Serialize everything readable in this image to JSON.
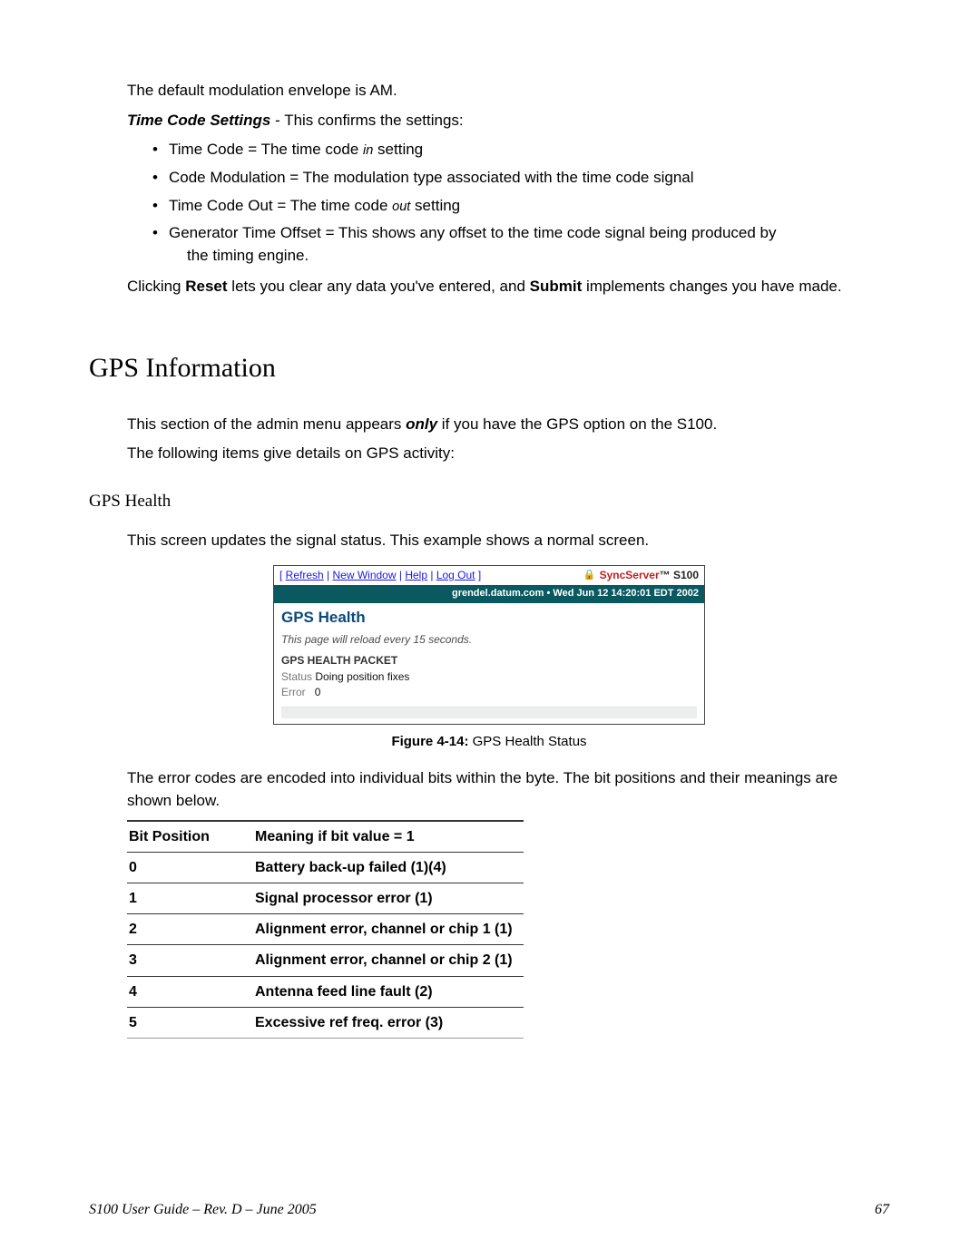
{
  "intro_para": "The default modulation envelope is AM.",
  "timecode_heading_bold": "Time Code Settings",
  "timecode_heading_rest": " - This confirms the settings:",
  "bullets": {
    "b1_a": "Time Code = The time code ",
    "b1_i": "in",
    "b1_b": " setting",
    "b2": "Code Modulation = The modulation type associated with the time code signal",
    "b3_a": "Time Code Out = The time code ",
    "b3_i": "out",
    "b3_b": " setting",
    "b4_line1": "Generator Time Offset = This shows any offset to the time code signal being produced by",
    "b4_line2": "the timing engine."
  },
  "reset_para_a": "Clicking ",
  "reset_word": "Reset",
  "reset_para_b": " lets you clear any data you've entered, and ",
  "submit_word": "Submit",
  "reset_para_c": " implements changes you have made.",
  "h2": "GPS Information",
  "gps_para1_a": "This section of the admin menu appears ",
  "gps_para1_b": "only",
  "gps_para1_c": " if you have the GPS option on the S100.",
  "gps_para2": "The following items give details on GPS activity:",
  "h3": "GPS Health",
  "gps_health_lead": "This screen updates the signal status. This example shows a normal screen.",
  "shot": {
    "nav_open": "[ ",
    "nav_links": [
      "Refresh",
      "New Window",
      "Help",
      "Log Out"
    ],
    "nav_sep": " | ",
    "nav_close": " ]",
    "brand_red": "SyncServer",
    "brand_tm": "™ S100",
    "bar": "grendel.datum.com  •  Wed Jun 12 14:20:01 EDT 2002",
    "title": "GPS Health",
    "note": "This page will reload every 15 seconds.",
    "sub": "GPS HEALTH PACKET",
    "row1_label": "Status",
    "row1_value": "Doing position fixes",
    "row2_label": "Error",
    "row2_value": "0"
  },
  "fig_label_bold": "Figure 4-14:",
  "fig_label_rest": "  GPS Health Status",
  "error_para": "The error codes are encoded into individual bits within the byte. The bit positions and their meanings are shown below.",
  "table": {
    "head_a": "Bit Position",
    "head_b": "Meaning if bit value = 1",
    "rows": [
      {
        "pos": "0",
        "meaning": "Battery back-up failed (1)(4)"
      },
      {
        "pos": "1",
        "meaning": "Signal processor error (1)"
      },
      {
        "pos": "2",
        "meaning": "Alignment error, channel or chip 1 (1)"
      },
      {
        "pos": "3",
        "meaning": "Alignment error, channel or chip 2 (1)"
      },
      {
        "pos": "4",
        "meaning": "Antenna feed line fault (2)"
      },
      {
        "pos": "5",
        "meaning": "Excessive ref freq. error (3)"
      }
    ]
  },
  "footer_left": "S100 User Guide – Rev. D – June 2005",
  "footer_right": "67"
}
